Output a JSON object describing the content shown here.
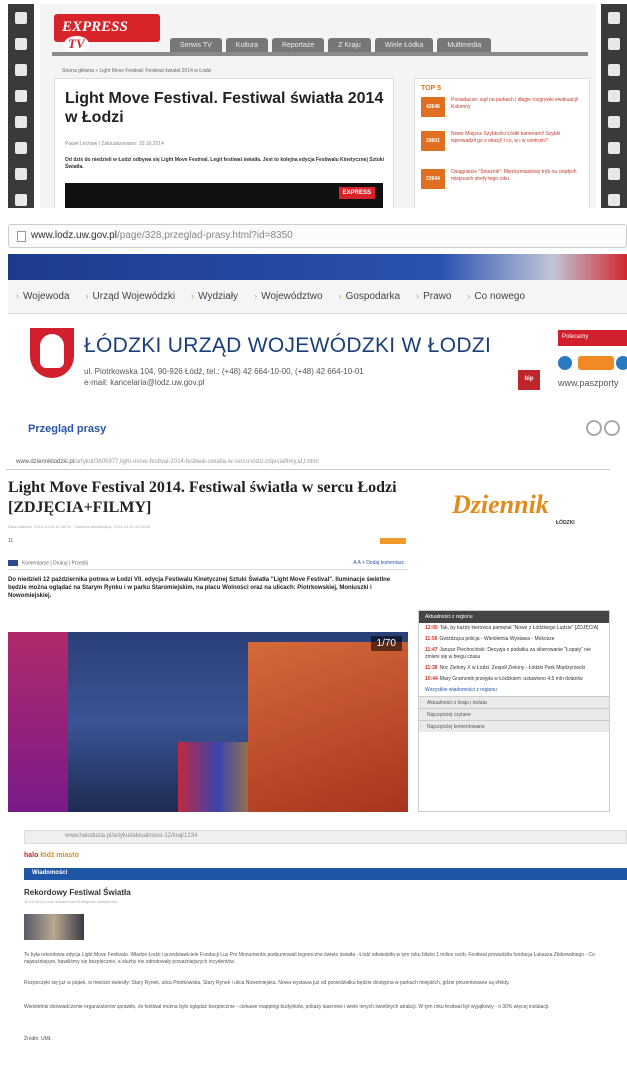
{
  "express_tv": {
    "logo_text": "EXPRESS",
    "logo_tv": "TV",
    "nav": [
      "Serwis TV",
      "Kultura",
      "Reportaże",
      "Z Kraju",
      "Wiele Łódka",
      "Multimedia"
    ],
    "breadcrumb": "Strona główna » Light Move Festival: Festiwal świateł 2014 w Łodzi",
    "title": "Light Move Festival. Festiwal światła 2014 w Łodzi",
    "meta": "Paweł Lechaw  |  Zaktualizowano: 10.10.2014",
    "lead": "Od dziś do niedzieli w Łodzi odbywa się Light Move Festival. Legit festiwal światła. Jest to kolejna edycja Festiwalu Kinetycznej Sztuki Światła.",
    "video_logo": "EXPRESS",
    "top_title": "TOP 5",
    "top_items": [
      {
        "thumb": "42646",
        "text": "Posiadacze: sąd na parkach i długie rozgrywki ewakuacji! Kolumny"
      },
      {
        "thumb": "28601",
        "text": "Nowe Miejsce Szybkości Łódki kamerami! Szybki wprowadził go z okazji! I co, w i w centrum?"
      },
      {
        "thumb": "22644",
        "text": "Osiągnięcie \"Śnieżnik\": Międzymiastowy tryb na ciepłych miejscach strefy tego roku"
      }
    ]
  },
  "urzad": {
    "url_host": "www.lodz.uw.gov.pl",
    "url_path": "/page/328,przeglad-prasy.html?id=8350",
    "nav": [
      "Wojewoda",
      "Urząd Wojewódzki",
      "Wydziały",
      "Województwo",
      "Gospodarka",
      "Prawo",
      "Co nowego"
    ],
    "org_name": "ŁÓDZKI URZĄD WOJEWÓDZKI W ŁODZI",
    "address_line1": "ul. Piotrkowska 104, 90-926 Łódź, tel.: (+48) 42 664-10-00, (+48) 42 664-10-01",
    "address_line2": "e-mail: kancelaria@lodz.uw.gov.pl",
    "bip": "bip",
    "right_label": "Polecamy",
    "right_link": "www.paszporty",
    "section_title": "Przegląd prasy"
  },
  "dziennik": {
    "url_host": "www.dzienniklodzki.pl",
    "url_path": "/artykul/3605977,light-move-festival-2014-festiwal-swiatla-w-sercu-lodzi-zdjeciafilmy,id,t.html",
    "title": "Light Move Festival 2014. Festiwal światła w sercu Łodzi [ZDJĘCIA+FILMY]",
    "meta": "Data dodania: 2014-10-10 11:45:00  ·  Ostatnia aktualizacja: 2014-10-11 10:28:00",
    "count": "11",
    "tools_left": "Komentarze  |  Drukuj  |  Prześlij",
    "tools_right": "A  A  + Dodaj komentarz",
    "lead": "Do niedzieli 12 października potrwa w Łodzi VII. edycja Festiwalu Kinetycznej Sztuki Światła \"Light Move Festival\". Iluminacje świetlne będzie można oglądać na Starym Rynku i w parku Staromiejskim, na placu Wolności oraz na ulicach: Piotrkowskiej, Moniuszki i Nowomiejskiej.",
    "photo_counter": "1/70",
    "logo": "Dziennik",
    "logo_sub": "ŁÓDZKI",
    "side_head": "Aktualności z regionu",
    "side_items": [
      {
        "time": "12:05",
        "text": "Tak, by każdy kierowca pamiętał \"Nowe z Łódzkiego Ludzie\" [ZDJĘCIA]"
      },
      {
        "time": "11:56",
        "text": "Gwiżdżąca policja - Wieloletnia Wystawa - Mokosze"
      },
      {
        "time": "11:47",
        "text": "Janusz Piechociński: Decyzja o podatku za skierowanie \"Łopaty\" nie zmieni się w biegu czasu"
      },
      {
        "time": "11:38",
        "text": "Noc Zielony X w Łodzi. Zespół Zielony - Łódzki Park Międzyrzecki"
      },
      {
        "time": "10:44",
        "text": "Mary Gramonik przejęła w Łódzkiem: ustawiono 4.5 mln dolarów"
      }
    ],
    "side_more": "Wszystkie wiadomości z regionu",
    "side_bars": [
      "Aktualności z kraju i świata",
      "Najczęściej czytane",
      "Najczęściej komentowane"
    ]
  },
  "haloduzia": {
    "url": "www.haloduzia.pl/artykul/aktualnosci-12/kraj/1234",
    "brand_first": "halo",
    "brand_second": "łódź miasto",
    "section": "Wiadomości",
    "title": "Rekordowy Festiwal Światła",
    "meta": "10.10.2014  Łódź  Wiadomości  Kategorie: Aktualności",
    "paragraphs": [
      "To była rekordowa edycja Light Move Festivalu. Władze Łodzi i przedstawiciele Fundacji Lux Pro Monumentis podsumowali tegoroczne święto światła - Łódź odwiedziło w tym roku blisko 1 milion osób. Festiwal prowadziła fundacja Łukasza Zbikowskiego - Co najważniejsze, bawiliśmy się bezpiecznie, a służby nie odnotowały poważniejszych incydentów.",
      "Rozpoczęło się już w piątek, w mieście świeciły: Stary Rynek, ulica Piotrkowska, Stary Rynek i ulica Nowomiejska. Nowa wystawa już od poniedziałku będzie dostępna w parkach miejskich, gdzie prezentowane są efekty.",
      "Wieloletnie doświadczenie organizatorów sprawiło, że festiwal można było oglądać bezpiecznie - ciekawe mappingi budynków, pokazy laserowe i wiele innych świetlnych atrakcji. W tym roku festiwal był wyjątkowy - o 30% więcej instalacji."
    ],
    "source": "Źródło: UMŁ"
  }
}
